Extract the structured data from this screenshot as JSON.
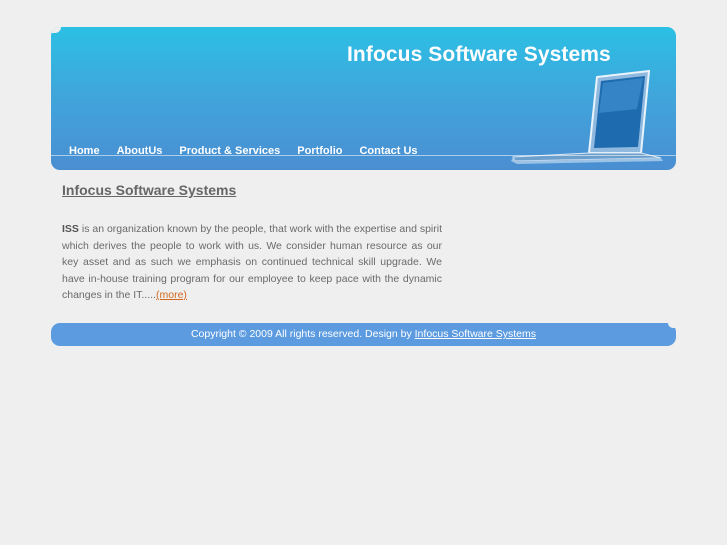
{
  "header": {
    "site_title": "Infocus Software Systems",
    "nav": [
      "Home",
      "AboutUs",
      "Product & Services",
      "Portfolio",
      "Contact Us"
    ]
  },
  "main": {
    "heading": "Infocus Software Systems",
    "intro_lead": "ISS",
    "intro_text": " is an organization known by the people, that work with the expertise and spirit which derives the people to work with us. We consider human resource as our key asset and as such we emphasis on continued technical skill upgrade. We have in-house training program for our employee to keep pace with the dynamic changes in the IT.....",
    "more_link": "(more)"
  },
  "footer": {
    "copyright": "Copyright © 2009 All rights reserved. Design by ",
    "designer_link": "Infocus Software Systems"
  },
  "colors": {
    "header_top": "#2bc0e4",
    "header_bottom": "#4a8ed2",
    "footer": "#5c9be0",
    "more_link": "#d2691e",
    "background": "#efefef"
  }
}
